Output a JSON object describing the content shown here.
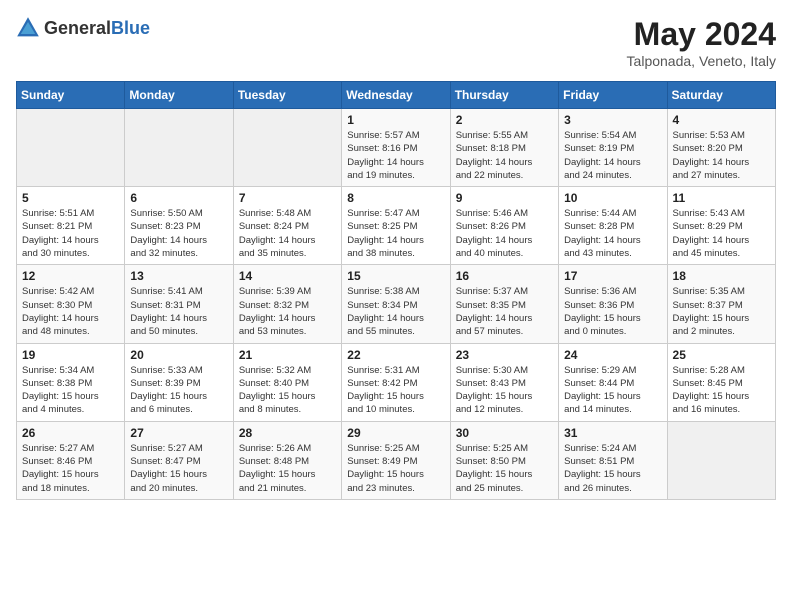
{
  "header": {
    "logo_general": "General",
    "logo_blue": "Blue",
    "month_year": "May 2024",
    "location": "Talponada, Veneto, Italy"
  },
  "days_of_week": [
    "Sunday",
    "Monday",
    "Tuesday",
    "Wednesday",
    "Thursday",
    "Friday",
    "Saturday"
  ],
  "weeks": [
    [
      {
        "day": "",
        "info": ""
      },
      {
        "day": "",
        "info": ""
      },
      {
        "day": "",
        "info": ""
      },
      {
        "day": "1",
        "info": "Sunrise: 5:57 AM\nSunset: 8:16 PM\nDaylight: 14 hours\nand 19 minutes."
      },
      {
        "day": "2",
        "info": "Sunrise: 5:55 AM\nSunset: 8:18 PM\nDaylight: 14 hours\nand 22 minutes."
      },
      {
        "day": "3",
        "info": "Sunrise: 5:54 AM\nSunset: 8:19 PM\nDaylight: 14 hours\nand 24 minutes."
      },
      {
        "day": "4",
        "info": "Sunrise: 5:53 AM\nSunset: 8:20 PM\nDaylight: 14 hours\nand 27 minutes."
      }
    ],
    [
      {
        "day": "5",
        "info": "Sunrise: 5:51 AM\nSunset: 8:21 PM\nDaylight: 14 hours\nand 30 minutes."
      },
      {
        "day": "6",
        "info": "Sunrise: 5:50 AM\nSunset: 8:23 PM\nDaylight: 14 hours\nand 32 minutes."
      },
      {
        "day": "7",
        "info": "Sunrise: 5:48 AM\nSunset: 8:24 PM\nDaylight: 14 hours\nand 35 minutes."
      },
      {
        "day": "8",
        "info": "Sunrise: 5:47 AM\nSunset: 8:25 PM\nDaylight: 14 hours\nand 38 minutes."
      },
      {
        "day": "9",
        "info": "Sunrise: 5:46 AM\nSunset: 8:26 PM\nDaylight: 14 hours\nand 40 minutes."
      },
      {
        "day": "10",
        "info": "Sunrise: 5:44 AM\nSunset: 8:28 PM\nDaylight: 14 hours\nand 43 minutes."
      },
      {
        "day": "11",
        "info": "Sunrise: 5:43 AM\nSunset: 8:29 PM\nDaylight: 14 hours\nand 45 minutes."
      }
    ],
    [
      {
        "day": "12",
        "info": "Sunrise: 5:42 AM\nSunset: 8:30 PM\nDaylight: 14 hours\nand 48 minutes."
      },
      {
        "day": "13",
        "info": "Sunrise: 5:41 AM\nSunset: 8:31 PM\nDaylight: 14 hours\nand 50 minutes."
      },
      {
        "day": "14",
        "info": "Sunrise: 5:39 AM\nSunset: 8:32 PM\nDaylight: 14 hours\nand 53 minutes."
      },
      {
        "day": "15",
        "info": "Sunrise: 5:38 AM\nSunset: 8:34 PM\nDaylight: 14 hours\nand 55 minutes."
      },
      {
        "day": "16",
        "info": "Sunrise: 5:37 AM\nSunset: 8:35 PM\nDaylight: 14 hours\nand 57 minutes."
      },
      {
        "day": "17",
        "info": "Sunrise: 5:36 AM\nSunset: 8:36 PM\nDaylight: 15 hours\nand 0 minutes."
      },
      {
        "day": "18",
        "info": "Sunrise: 5:35 AM\nSunset: 8:37 PM\nDaylight: 15 hours\nand 2 minutes."
      }
    ],
    [
      {
        "day": "19",
        "info": "Sunrise: 5:34 AM\nSunset: 8:38 PM\nDaylight: 15 hours\nand 4 minutes."
      },
      {
        "day": "20",
        "info": "Sunrise: 5:33 AM\nSunset: 8:39 PM\nDaylight: 15 hours\nand 6 minutes."
      },
      {
        "day": "21",
        "info": "Sunrise: 5:32 AM\nSunset: 8:40 PM\nDaylight: 15 hours\nand 8 minutes."
      },
      {
        "day": "22",
        "info": "Sunrise: 5:31 AM\nSunset: 8:42 PM\nDaylight: 15 hours\nand 10 minutes."
      },
      {
        "day": "23",
        "info": "Sunrise: 5:30 AM\nSunset: 8:43 PM\nDaylight: 15 hours\nand 12 minutes."
      },
      {
        "day": "24",
        "info": "Sunrise: 5:29 AM\nSunset: 8:44 PM\nDaylight: 15 hours\nand 14 minutes."
      },
      {
        "day": "25",
        "info": "Sunrise: 5:28 AM\nSunset: 8:45 PM\nDaylight: 15 hours\nand 16 minutes."
      }
    ],
    [
      {
        "day": "26",
        "info": "Sunrise: 5:27 AM\nSunset: 8:46 PM\nDaylight: 15 hours\nand 18 minutes."
      },
      {
        "day": "27",
        "info": "Sunrise: 5:27 AM\nSunset: 8:47 PM\nDaylight: 15 hours\nand 20 minutes."
      },
      {
        "day": "28",
        "info": "Sunrise: 5:26 AM\nSunset: 8:48 PM\nDaylight: 15 hours\nand 21 minutes."
      },
      {
        "day": "29",
        "info": "Sunrise: 5:25 AM\nSunset: 8:49 PM\nDaylight: 15 hours\nand 23 minutes."
      },
      {
        "day": "30",
        "info": "Sunrise: 5:25 AM\nSunset: 8:50 PM\nDaylight: 15 hours\nand 25 minutes."
      },
      {
        "day": "31",
        "info": "Sunrise: 5:24 AM\nSunset: 8:51 PM\nDaylight: 15 hours\nand 26 minutes."
      },
      {
        "day": "",
        "info": ""
      }
    ]
  ]
}
